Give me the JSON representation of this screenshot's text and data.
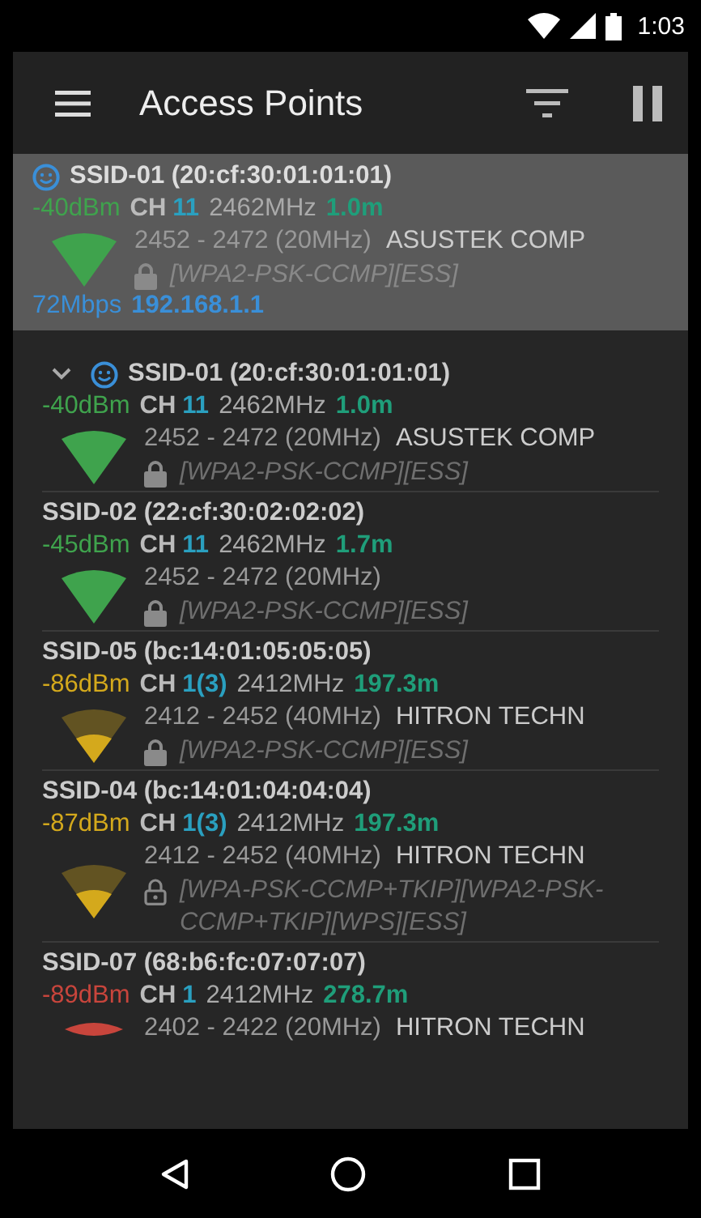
{
  "status_bar": {
    "time": "1:03"
  },
  "toolbar": {
    "title": "Access Points"
  },
  "dragged_entry": {
    "ssid": "SSID-01 (20:cf:30:01:01:01)",
    "connected": true,
    "expanded": false,
    "rssi": "-40dBm",
    "color": "#3fa34d",
    "kind": "strong",
    "ch_label": "CH",
    "channel": "11",
    "frequency": "2462MHz",
    "distance": "1.0m",
    "range": "2452 - 2472 (20MHz)",
    "vendor": "ASUSTEK COMP",
    "lock_open": false,
    "security": "[WPA2-PSK-CCMP][ESS]",
    "link_speed": "72Mbps",
    "ip": "192.168.1.1"
  },
  "access_points": [
    {
      "ssid": "SSID-01 (20:cf:30:01:01:01)",
      "connected": true,
      "expanded": true,
      "rssi": "-40dBm",
      "color": "#3fa34d",
      "kind": "strong",
      "ch_label": "CH",
      "channel": "11",
      "frequency": "2462MHz",
      "distance": "1.0m",
      "range": "2452 - 2472 (20MHz)",
      "vendor": "ASUSTEK COMP",
      "lock_open": false,
      "security": "[WPA2-PSK-CCMP][ESS]"
    },
    {
      "ssid": "SSID-02 (22:cf:30:02:02:02)",
      "connected": false,
      "expanded": false,
      "rssi": "-45dBm",
      "color": "#3fa34d",
      "kind": "strong",
      "ch_label": "CH",
      "channel": "11",
      "frequency": "2462MHz",
      "distance": "1.7m",
      "range": "2452 - 2472 (20MHz)",
      "lock_open": false,
      "security": "[WPA2-PSK-CCMP][ESS]"
    },
    {
      "ssid": "SSID-05 (bc:14:01:05:05:05)",
      "connected": false,
      "expanded": false,
      "rssi": "-86dBm",
      "color": "#d4a91c",
      "kind": "fair",
      "ch_label": "CH",
      "channel": "1(3)",
      "frequency": "2412MHz",
      "distance": "197.3m",
      "range": "2412 - 2452 (40MHz)",
      "vendor": "HITRON TECHN",
      "lock_open": false,
      "security": "[WPA2-PSK-CCMP][ESS]"
    },
    {
      "ssid": "SSID-04 (bc:14:01:04:04:04)",
      "connected": false,
      "expanded": false,
      "rssi": "-87dBm",
      "color": "#d4a91c",
      "kind": "fair",
      "ch_label": "CH",
      "channel": "1(3)",
      "frequency": "2412MHz",
      "distance": "197.3m",
      "range": "2412 - 2452 (40MHz)",
      "vendor": "HITRON TECHN",
      "lock_open": true,
      "security": "[WPA-PSK-CCMP+TKIP][WPA2-PSK-CCMP+TKIP][WPS][ESS]"
    },
    {
      "ssid": "SSID-07 (68:b6:fc:07:07:07)",
      "connected": false,
      "expanded": false,
      "rssi": "-89dBm",
      "color": "#c8453c",
      "kind": "weak",
      "ch_label": "CH",
      "channel": "1",
      "frequency": "2412MHz",
      "distance": "278.7m",
      "range": "2402 - 2422 (20MHz)",
      "vendor": "HITRON TECHN"
    }
  ]
}
